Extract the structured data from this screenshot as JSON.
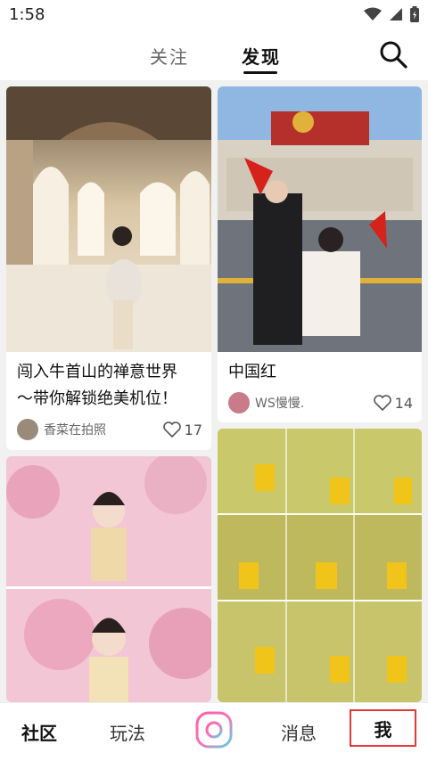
{
  "status_bar": {
    "time": "1:58",
    "icons": [
      "wifi-icon",
      "signal-icon",
      "battery-icon"
    ]
  },
  "top_nav": {
    "tabs": [
      {
        "label": "关注",
        "active": false
      },
      {
        "label": "发现",
        "active": true
      }
    ],
    "search_icon": "search-icon"
  },
  "feed": {
    "cards": [
      {
        "title_line1": "闯入牛首山的禅意世界",
        "title_line2": "～带你解锁绝美机位！",
        "author": "香菜在拍照",
        "likes": "17",
        "image": "palace-corridor-photo"
      },
      {
        "title": "中国红",
        "author": "WS慢慢.",
        "likes": "14",
        "image": "couple-flags-photo"
      },
      {
        "image": "cherry-blossom-photo"
      },
      {
        "image": "yellow-flowers-collage-photo"
      }
    ]
  },
  "bottom_nav": {
    "items": [
      "社区",
      "玩法",
      "消息",
      "我"
    ],
    "camera_icon": "camera-icon",
    "highlight_color": "#e53935"
  }
}
